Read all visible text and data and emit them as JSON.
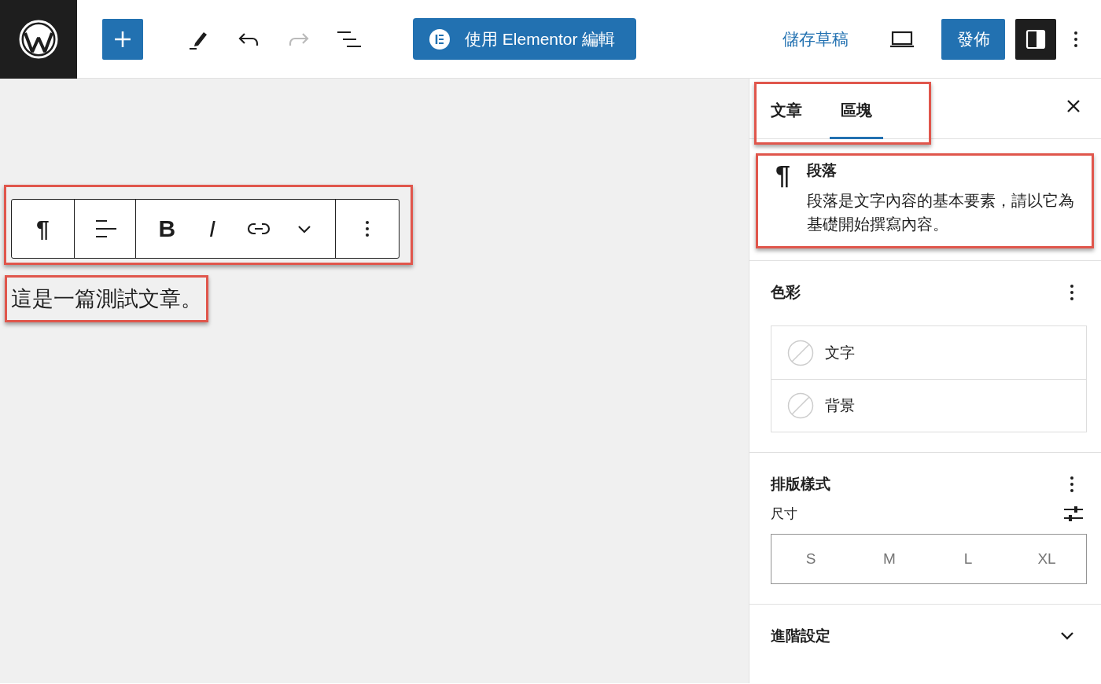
{
  "top_bar": {
    "tools": [
      {
        "kind": "inserter",
        "disabled": false
      },
      {
        "kind": "tools",
        "disabled": false
      },
      {
        "kind": "undo",
        "disabled": false
      },
      {
        "kind": "redo",
        "disabled": true
      },
      {
        "kind": "list-view",
        "disabled": false
      }
    ],
    "elementor_button": "使用 Elementor 編輯",
    "save_draft": "儲存草稿",
    "publish": "發佈",
    "settings_toggle": {
      "pressed": true
    }
  },
  "canvas": {
    "paragraph": "這是一篇測試文章。",
    "paragraph_highlighted": true,
    "block_toolbar": {
      "highlighted": true,
      "groups": [
        [
          {
            "kind": "block-type",
            "glyph": "¶"
          }
        ],
        [
          {
            "kind": "align"
          }
        ],
        [
          {
            "kind": "bold",
            "glyph": "B"
          },
          {
            "kind": "italic",
            "glyph": "I"
          },
          {
            "kind": "link"
          },
          {
            "kind": "more-formats"
          }
        ],
        [
          {
            "kind": "options"
          }
        ]
      ]
    }
  },
  "sidebar": {
    "tabs_highlighted": true,
    "tabs": [
      {
        "label": "文章",
        "selected": false
      },
      {
        "label": "區塊",
        "selected": true
      }
    ],
    "block_card": {
      "highlighted": true,
      "glyph": "¶",
      "title": "段落",
      "description": "段落是文字內容的基本要素，請以它為基礎開始撰寫內容。"
    },
    "panels": [
      {
        "kind": "color",
        "title": "色彩",
        "items": [
          "文字",
          "背景"
        ]
      },
      {
        "kind": "typography",
        "title": "排版樣式",
        "size_label": "尺寸",
        "sizes": [
          {
            "label": "S",
            "selected": false
          },
          {
            "label": "M",
            "selected": false
          },
          {
            "label": "L",
            "selected": false
          },
          {
            "label": "XL",
            "selected": false
          }
        ]
      },
      {
        "kind": "advanced",
        "title": "進階設定",
        "expanded": false
      }
    ]
  }
}
